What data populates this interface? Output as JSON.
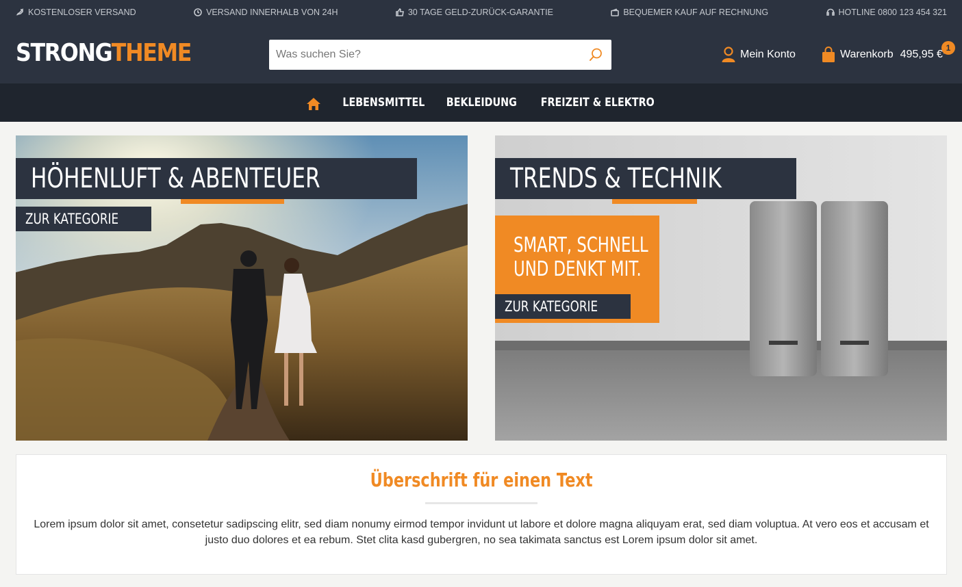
{
  "topbar": {
    "items": [
      {
        "icon": "rocket-icon",
        "label": "KOSTENLOSER VERSAND"
      },
      {
        "icon": "clock-icon",
        "label": "VERSAND INNERHALB VON 24H"
      },
      {
        "icon": "thumbs-up-icon",
        "label": "30 TAGE GELD-ZURÜCK-GARANTIE"
      },
      {
        "icon": "wallet-icon",
        "label": "BEQUEMER KAUF AUF RECHNUNG"
      },
      {
        "icon": "headset-icon",
        "label": "HOTLINE 0800 123 454 321"
      }
    ]
  },
  "header": {
    "logo_part1": "STRONG",
    "logo_part2": "THEME",
    "search_placeholder": "Was suchen Sie?",
    "account_label": "Mein Konto",
    "cart_label": "Warenkorb",
    "cart_price": "495,95 €*",
    "cart_count": "1"
  },
  "nav": {
    "items": [
      "LEBENSMITTEL",
      "BEKLEIDUNG",
      "FREIZEIT & ELEKTRO"
    ]
  },
  "banners": {
    "left": {
      "title": "HÖHENLUFT & ABENTEUER",
      "button": "ZUR KATEGORIE"
    },
    "right": {
      "title": "TRENDS & TECHNIK",
      "tagline_line1": "SMART, SCHNELL",
      "tagline_line2": "UND DENKT MIT.",
      "button": "ZUR KATEGORIE"
    }
  },
  "textblock": {
    "heading": "Überschrift für einen Text",
    "body": "Lorem ipsum dolor sit amet, consetetur sadipscing elitr, sed diam nonumy eirmod tempor invidunt ut labore et dolore magna aliquyam erat, sed diam voluptua. At vero eos et accusam et justo duo dolores et ea rebum. Stet clita kasd gubergren, no sea takimata sanctus est Lorem ipsum dolor sit amet."
  },
  "colors": {
    "accent": "#f08a24",
    "header_bg": "#2c3340",
    "nav_bg": "#1f252e"
  }
}
